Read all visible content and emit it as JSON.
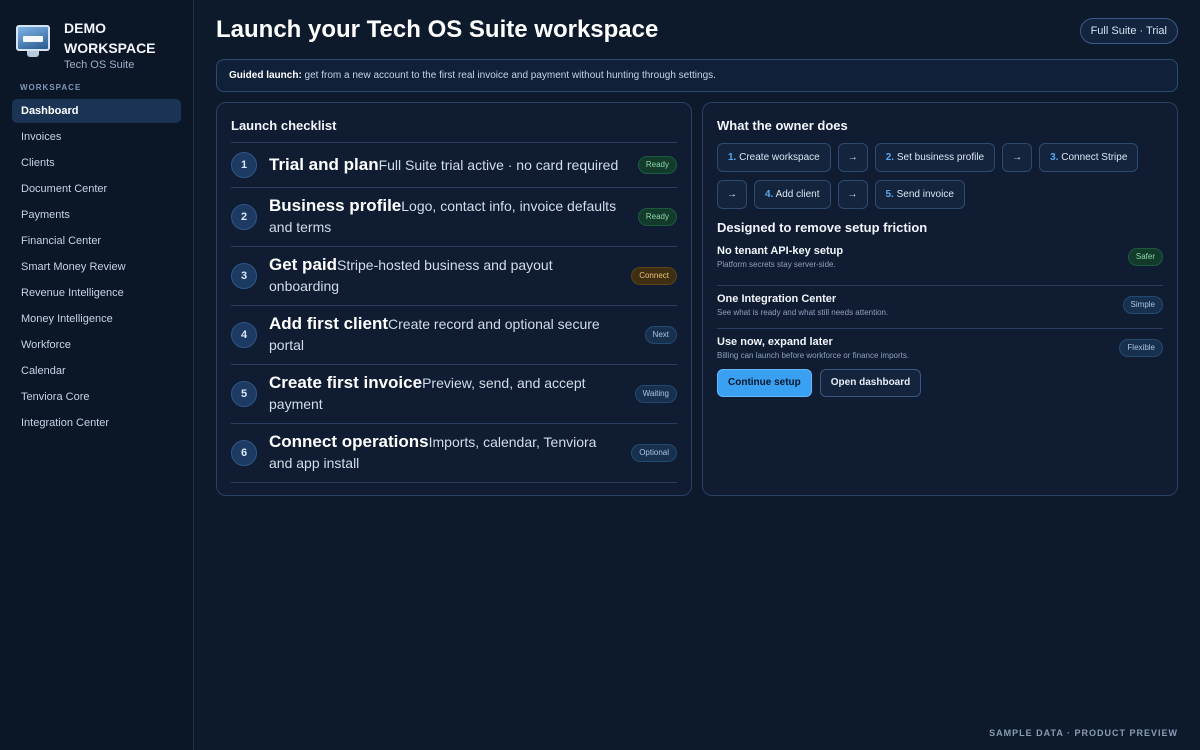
{
  "brand": {
    "name": "Demo Workspace",
    "subtitle": "Tech OS Suite"
  },
  "sidebar": {
    "section_label": "WORKSPACE",
    "items": [
      {
        "label": "Dashboard",
        "active": true
      },
      {
        "label": "Invoices"
      },
      {
        "label": "Clients"
      },
      {
        "label": "Document Center"
      },
      {
        "label": "Payments"
      },
      {
        "label": "Financial Center"
      },
      {
        "label": "Smart Money Review"
      },
      {
        "label": "Revenue Intelligence"
      },
      {
        "label": "Money Intelligence"
      },
      {
        "label": "Workforce"
      },
      {
        "label": "Calendar"
      },
      {
        "label": "Tenviora Core"
      },
      {
        "label": "Integration Center"
      }
    ]
  },
  "header": {
    "title": "Launch your Tech OS Suite workspace",
    "plan_chip": "Full Suite · Trial"
  },
  "banner": {
    "label": "Guided launch:",
    "text": " get from a new account to the first real invoice and payment without hunting through settings."
  },
  "checklist": {
    "title": "Launch checklist",
    "steps": [
      {
        "num": "1",
        "title": "Trial and plan",
        "desc": "Full Suite trial active · no card required",
        "status": "Ready",
        "tone": "ready"
      },
      {
        "num": "2",
        "title": "Business profile",
        "desc": "Logo, contact info, invoice defaults and terms",
        "status": "Ready",
        "tone": "ready"
      },
      {
        "num": "3",
        "title": "Get paid",
        "desc": "Stripe-hosted business and payout onboarding",
        "status": "Connect",
        "tone": "connect"
      },
      {
        "num": "4",
        "title": "Add first client",
        "desc": "Create record and optional secure portal",
        "status": "Next",
        "tone": "neutral"
      },
      {
        "num": "5",
        "title": "Create first invoice",
        "desc": "Preview, send, and accept payment",
        "status": "Waiting",
        "tone": "neutral"
      },
      {
        "num": "6",
        "title": "Connect operations",
        "desc": "Imports, calendar, Tenviora and app install",
        "status": "Optional",
        "tone": "neutral"
      }
    ]
  },
  "owner": {
    "title": "What the owner does",
    "arrow": "→",
    "flow": [
      {
        "num": "1.",
        "label": "Create workspace"
      },
      {
        "num": "2.",
        "label": "Set business profile"
      },
      {
        "num": "3.",
        "label": "Connect Stripe"
      },
      {
        "num": "4.",
        "label": "Add client"
      },
      {
        "num": "5.",
        "label": "Send invoice"
      }
    ],
    "friction_title": "Designed to remove setup friction",
    "features": [
      {
        "title": "No tenant API-key setup",
        "desc": "Platform secrets stay server-side.",
        "badge": "Safer",
        "tone": "ready"
      },
      {
        "title": "One Integration Center",
        "desc": "See what is ready and what still needs attention.",
        "badge": "Simple",
        "tone": "neutral"
      },
      {
        "title": "Use now, expand later",
        "desc": "Billing can launch before workforce or finance imports.",
        "badge": "Flexible",
        "tone": "neutral"
      }
    ],
    "primary_button": "Continue setup",
    "secondary_button": "Open dashboard"
  },
  "footer": {
    "note": "SAMPLE DATA · PRODUCT PREVIEW"
  },
  "colors": {
    "accent": "#3aa0f2",
    "ready": "#8fd6ab",
    "connect": "#e8c27a",
    "background": "#0d1a2c"
  }
}
